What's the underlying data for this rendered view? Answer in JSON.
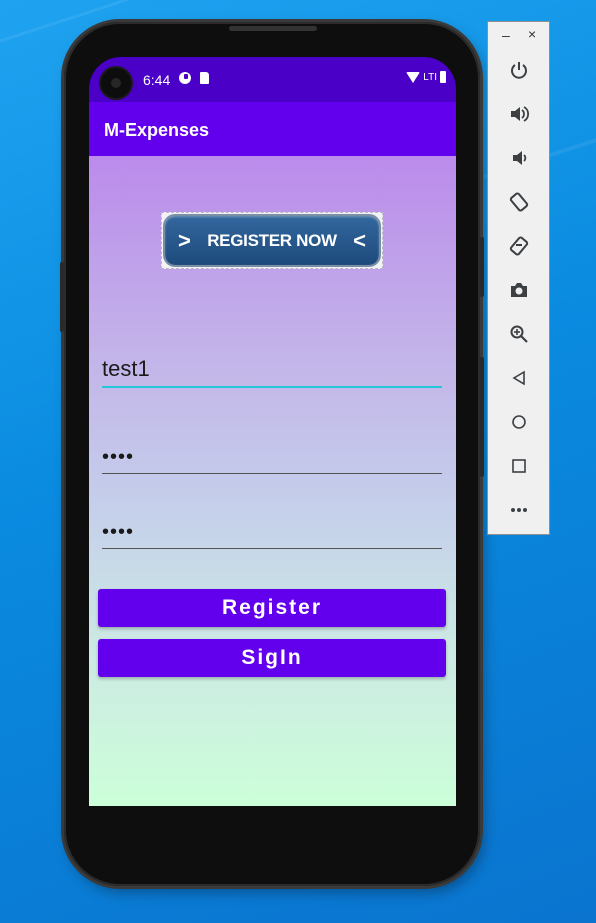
{
  "status_bar": {
    "time": "6:44",
    "network_label": "LTI"
  },
  "app": {
    "title": "M-Expenses"
  },
  "banner": {
    "text": "REGISTER NOW",
    "left_glyph": ">",
    "right_glyph": "<"
  },
  "form": {
    "username_value": "test1",
    "password_value": "••••",
    "confirm_password_value": "••••",
    "register_label": "Register",
    "signin_label": "SigIn"
  },
  "emulator_panel": {
    "minimize_label": "–",
    "close_label": "×",
    "tools": [
      {
        "name": "power-icon",
        "glyph": "⏻"
      },
      {
        "name": "volume-up-icon",
        "glyph": "🔊"
      },
      {
        "name": "volume-down-icon",
        "glyph": "🔉"
      },
      {
        "name": "rotate-left-icon",
        "glyph": "⟲"
      },
      {
        "name": "rotate-right-icon",
        "glyph": "⟳"
      },
      {
        "name": "camera-icon",
        "glyph": "📷"
      },
      {
        "name": "zoom-icon",
        "glyph": "🔍"
      },
      {
        "name": "back-icon",
        "glyph": "◁"
      },
      {
        "name": "home-icon",
        "glyph": "○"
      },
      {
        "name": "overview-icon",
        "glyph": "□"
      },
      {
        "name": "more-icon",
        "glyph": "•••"
      }
    ]
  },
  "colors": {
    "status_bar": "#4b00c8",
    "app_bar": "#6200ee",
    "button": "#6200ee",
    "active_underline": "#26c6da",
    "desktop": "#0a8be0"
  }
}
